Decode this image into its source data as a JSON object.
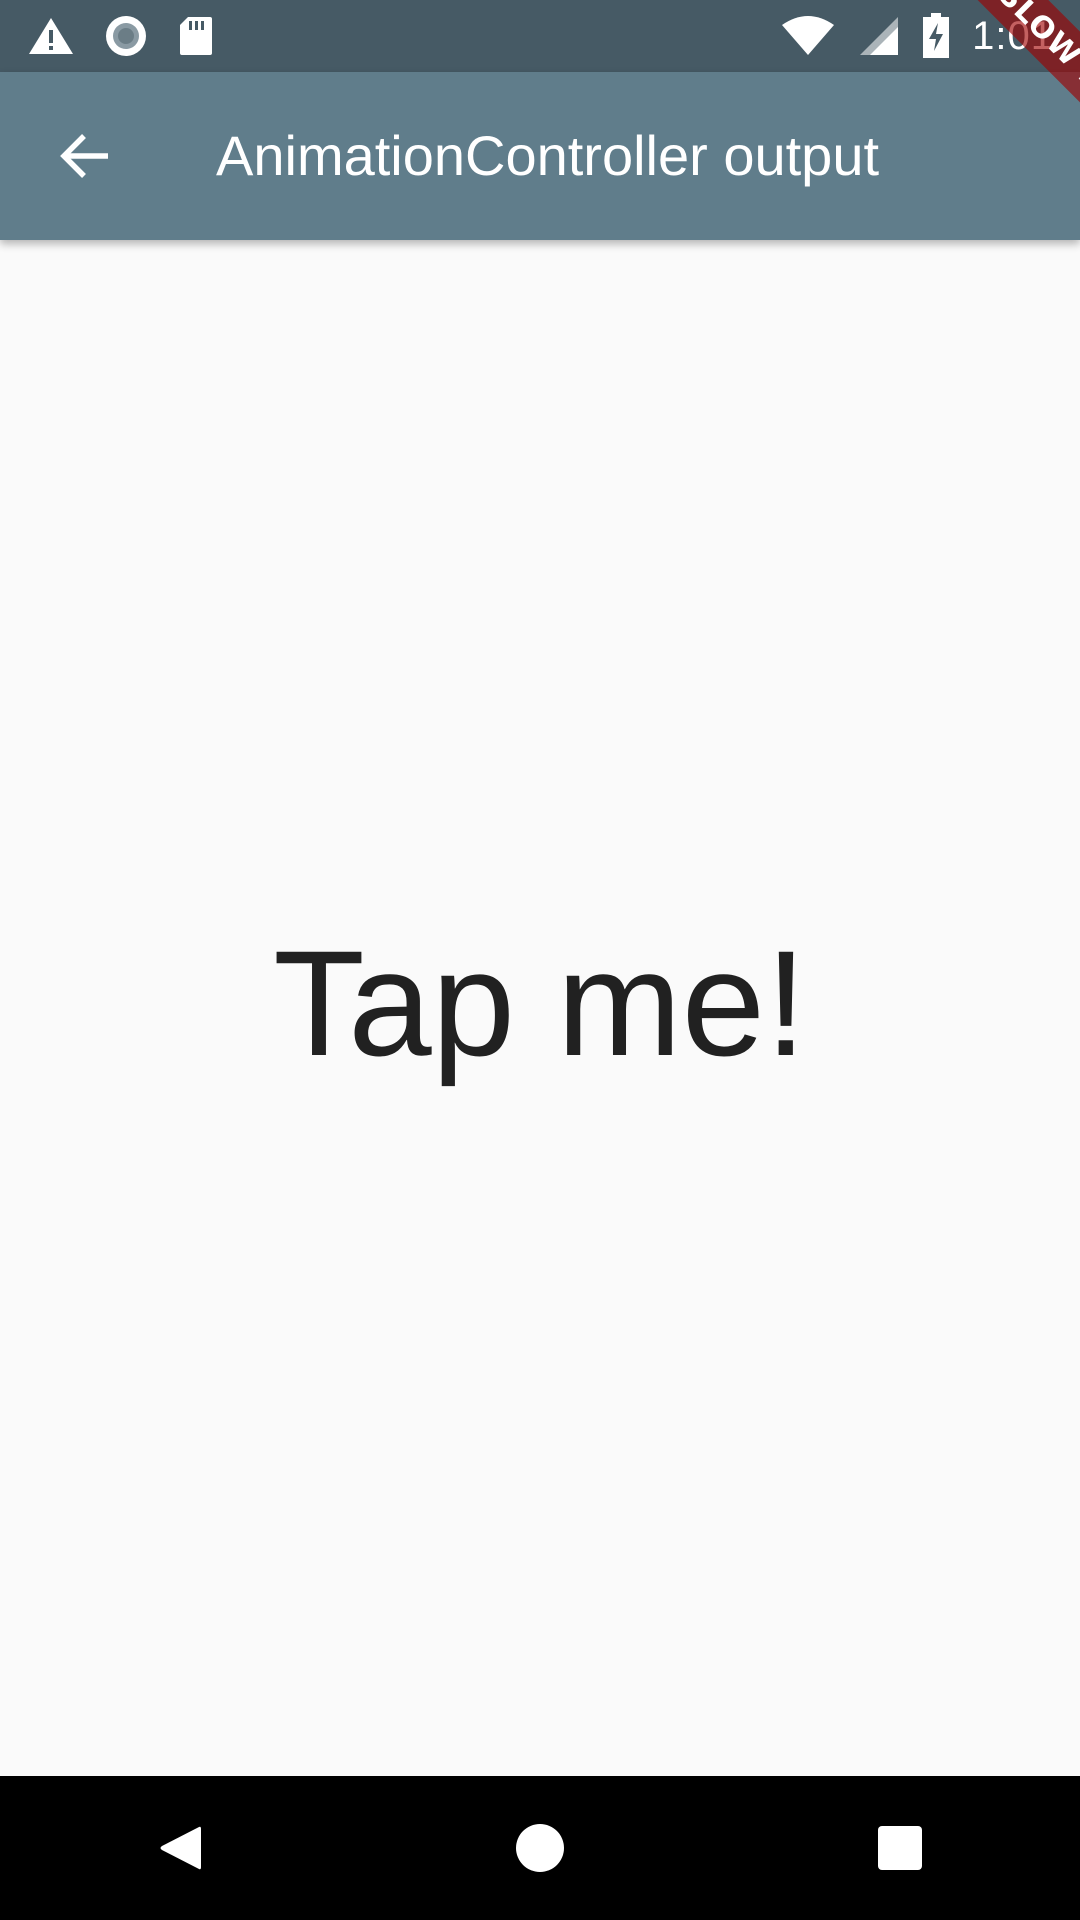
{
  "status_bar": {
    "time": "1:01",
    "left_icons": [
      "warning-icon",
      "sync-icon",
      "sd-card-icon"
    ],
    "right_icons": [
      "wifi-icon",
      "signal-icon",
      "battery-charging-icon"
    ]
  },
  "app_bar": {
    "title": "AnimationController output",
    "back_icon": "arrow-back-icon"
  },
  "banner": {
    "label": "SLOW MODE"
  },
  "body": {
    "tap_text": "Tap me!"
  },
  "nav_bar": {
    "buttons": [
      "back-triangle-icon",
      "home-circle-icon",
      "recents-square-icon"
    ]
  },
  "colors": {
    "status_bar": "#465a65",
    "app_bar": "#607d8b",
    "background": "#fafafa",
    "text": "#212121",
    "banner": "#a00000"
  }
}
